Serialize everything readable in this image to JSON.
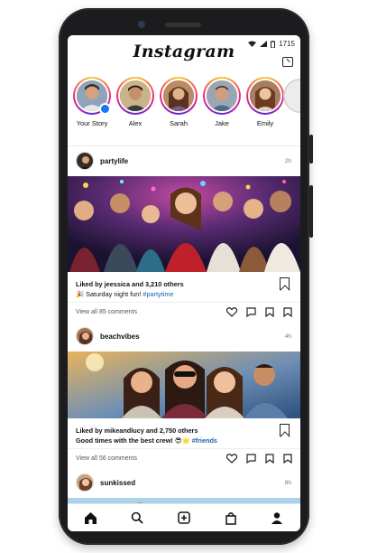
{
  "app": {
    "title": "Instagram"
  },
  "status_bar": {
    "battery": "1715",
    "signal_icon": "signal-icon",
    "wifi_icon": "wifi-icon",
    "battery_icon": "battery-icon"
  },
  "stories": [
    {
      "label": "Your Story"
    },
    {
      "label": "Alex"
    },
    {
      "label": "Sarah"
    },
    {
      "label": "Jake"
    },
    {
      "label": "Emily"
    }
  ],
  "posts": [
    {
      "user": "partylife",
      "time": "2h",
      "likes": "Liked by jeessica and 3,210 others",
      "caption_text": "🎉 Saturday night fun! ",
      "caption_tag": "#partytime",
      "comments": "View all 85 comments"
    },
    {
      "user": "beachvibes",
      "time": "4h",
      "likes": "Liked by mikeandlucy and 2,750 others",
      "caption_text": "Good times with the best crew! 😎🌟 ",
      "caption_tag": "#friends",
      "comments": "View all 56 comments"
    },
    {
      "user": "sunkissed",
      "time": "8h"
    }
  ],
  "colors": {
    "accent": "#1877f2",
    "link": "#1a5fa8",
    "ring_start": "#f9ce34",
    "ring_mid": "#ee2a7b",
    "ring_end": "#6228d7"
  },
  "nav": {
    "icons": [
      "home-icon",
      "search-icon",
      "add-post-icon",
      "shopping-bag-icon",
      "profile-icon"
    ]
  }
}
